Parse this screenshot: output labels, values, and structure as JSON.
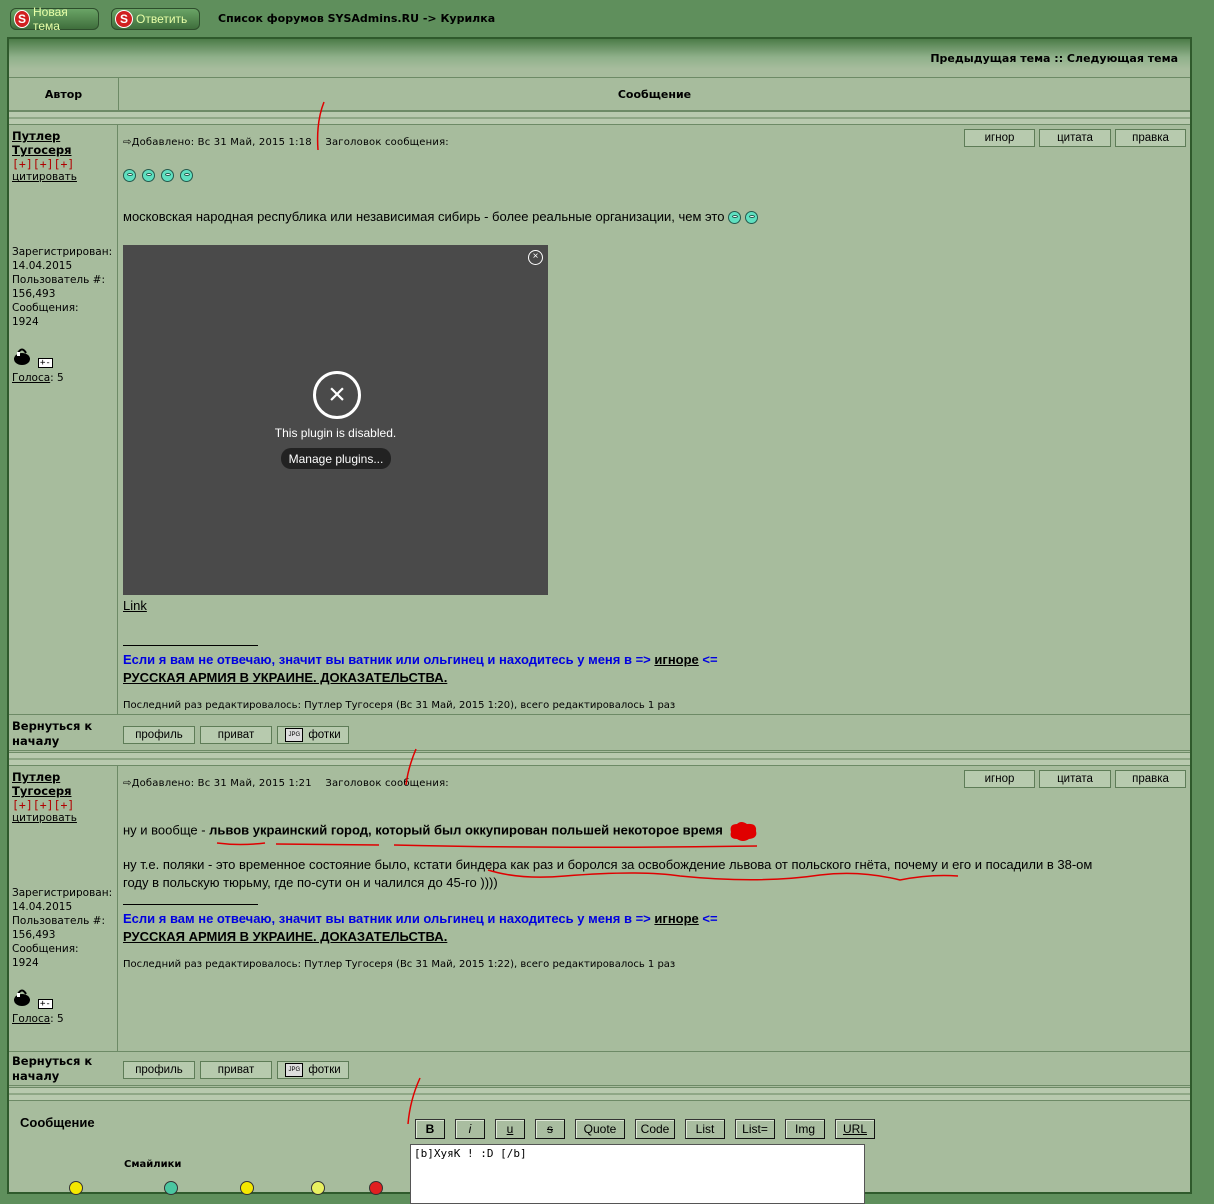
{
  "topbar": {
    "new_topic": "Новая тема",
    "reply": "Ответить",
    "breadcrumb": "Список форумов SYSAdmins.RU -> Курилка"
  },
  "nav": {
    "links": "Предыдущая тема :: Следующая тема"
  },
  "table_header": {
    "author": "Автор",
    "message": "Сообщение"
  },
  "post_buttons": [
    "игнор",
    "цитата",
    "правка"
  ],
  "back": {
    "label": "Вернуться к началу",
    "buttons": [
      "профиль",
      "приват",
      "фотки"
    ]
  },
  "posts": [
    {
      "author": "Путлер Тугосеря",
      "rank": "[+][+][+]",
      "quote_link": "цитировать",
      "registered_label": "Зарегистрирован:",
      "registered": "14.04.2015",
      "user_num_label": "Пользователь #:",
      "user_num": "156,493",
      "messages_label": "Сообщения:",
      "messages": "1924",
      "votes_label": "Голоса",
      "votes": ": 5",
      "posted": "Добавлено: Вс 31 Май, 2015 1:18",
      "subject_label": "Заголовок сообщения:",
      "text": "московская народная республика или независимая сибирь - более реальные организации, чем это",
      "plugin_message": "This plugin is disabled.",
      "plugin_button": "Manage plugins...",
      "link": "Link",
      "edited": "Последний раз редактировалось: Путлер Тугосеря (Вс 31 Май, 2015 1:20), всего редактировалось 1 раз"
    },
    {
      "author": "Путлер Тугосеря",
      "rank": "[+][+][+]",
      "quote_link": "цитировать",
      "registered_label": "Зарегистрирован:",
      "registered": "14.04.2015",
      "user_num_label": "Пользователь #:",
      "user_num": "156,493",
      "messages_label": "Сообщения:",
      "messages": "1924",
      "votes_label": "Голоса",
      "votes": ": 5",
      "posted": "Добавлено: Вс 31 Май, 2015 1:21",
      "subject_label": "Заголовок сообщения:",
      "line1_prefix": "ну и вообще - ",
      "line1_bold": "львов украинский город, который был оккупирован польшей некоторое время",
      "line2": "ну т.е. поляки - это временное состояние было, кстати биндера как раз и боролся за освобождение львова от польского гнёта, почему и его и посадили в 38-ом",
      "line3": "году в польскую тюрьму, где по-сути он и чалился до 45-го ))))",
      "edited": "Последний раз редактировалось: Путлер Тугосеря (Вс 31 Май, 2015 1:22), всего редактировалось 1 раз"
    }
  ],
  "signature": {
    "blue_text": "Если я вам не отвечаю, значит вы ватник или ольгинец и находитесь у меня в =>",
    "ignore_word": "игноре",
    "arrow": "<=",
    "army": "РУССКАЯ АРМИЯ В УКРАИНЕ. ДОКАЗАТЕЛЬСТВА."
  },
  "reply": {
    "title": "Сообщение",
    "smilies_title": "Смайлики",
    "format_buttons": [
      "B",
      "i",
      "u",
      "s",
      "Quote",
      "Code",
      "List",
      "List=",
      "Img",
      "URL"
    ],
    "text": "[b]ХуяК !  :D [/b]"
  },
  "colors": {
    "page_bg": "#5f8f5c",
    "panel_bg": "#a7bc9d",
    "signature_blue": "#0000e0",
    "rank_red": "#b00000",
    "annotation_red": "#e00000"
  }
}
